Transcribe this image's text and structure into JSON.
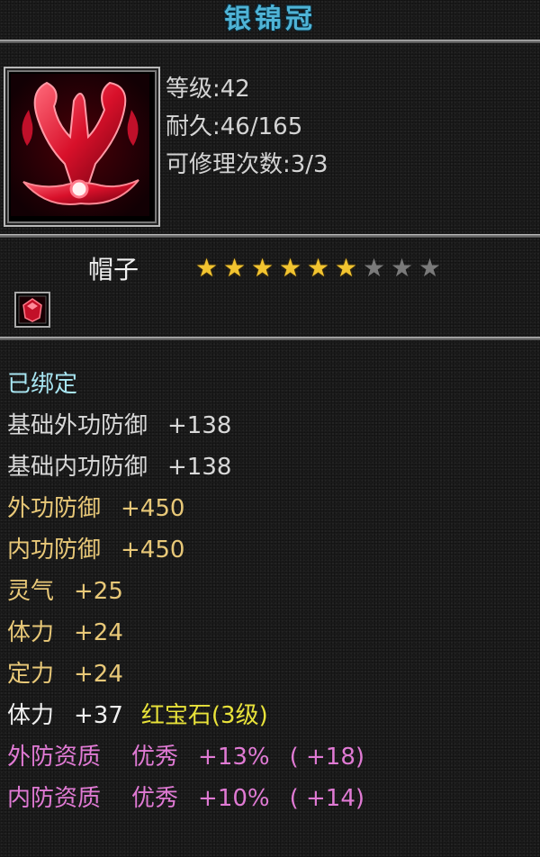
{
  "item": {
    "name": "银锦冠",
    "level_label": "等级:42",
    "durability_label": "耐久:46/165",
    "repair_label": "可修理次数:3/3",
    "type": "帽子",
    "stars_filled": 6,
    "stars_total": 9
  },
  "attributes": {
    "bound": "已绑定",
    "base_outer_defense": {
      "label": "基础外功防御",
      "value": "+138"
    },
    "base_inner_defense": {
      "label": "基础内功防御",
      "value": "+138"
    },
    "outer_defense": {
      "label": "外功防御",
      "value": "+450"
    },
    "inner_defense": {
      "label": "内功防御",
      "value": "+450"
    },
    "spirit": {
      "label": "灵气",
      "value": "+25"
    },
    "stamina": {
      "label": "体力",
      "value": "+24"
    },
    "focus": {
      "label": "定力",
      "value": "+24"
    },
    "gem_stamina": {
      "label": "体力",
      "value": "+37",
      "gem": "红宝石(3级)"
    },
    "outer_quality": {
      "label": "外防资质",
      "grade": "优秀",
      "value": "+13%",
      "bonus": "( +18)"
    },
    "inner_quality": {
      "label": "内防资质",
      "grade": "优秀",
      "value": "+10%",
      "bonus": "( +14)"
    }
  },
  "colors": {
    "title": "#4fb4d6",
    "bound": "#a8e6f2",
    "base": "#d8d8d8",
    "bonus": "#e8c878",
    "gem": "#e8e23a",
    "quality": "#e07ad4",
    "star_on": "#f2c430",
    "star_off": "#7a7a7a"
  },
  "icons": {
    "portrait": "red-crown-icon",
    "gem_slot": "ruby-gem-icon"
  }
}
